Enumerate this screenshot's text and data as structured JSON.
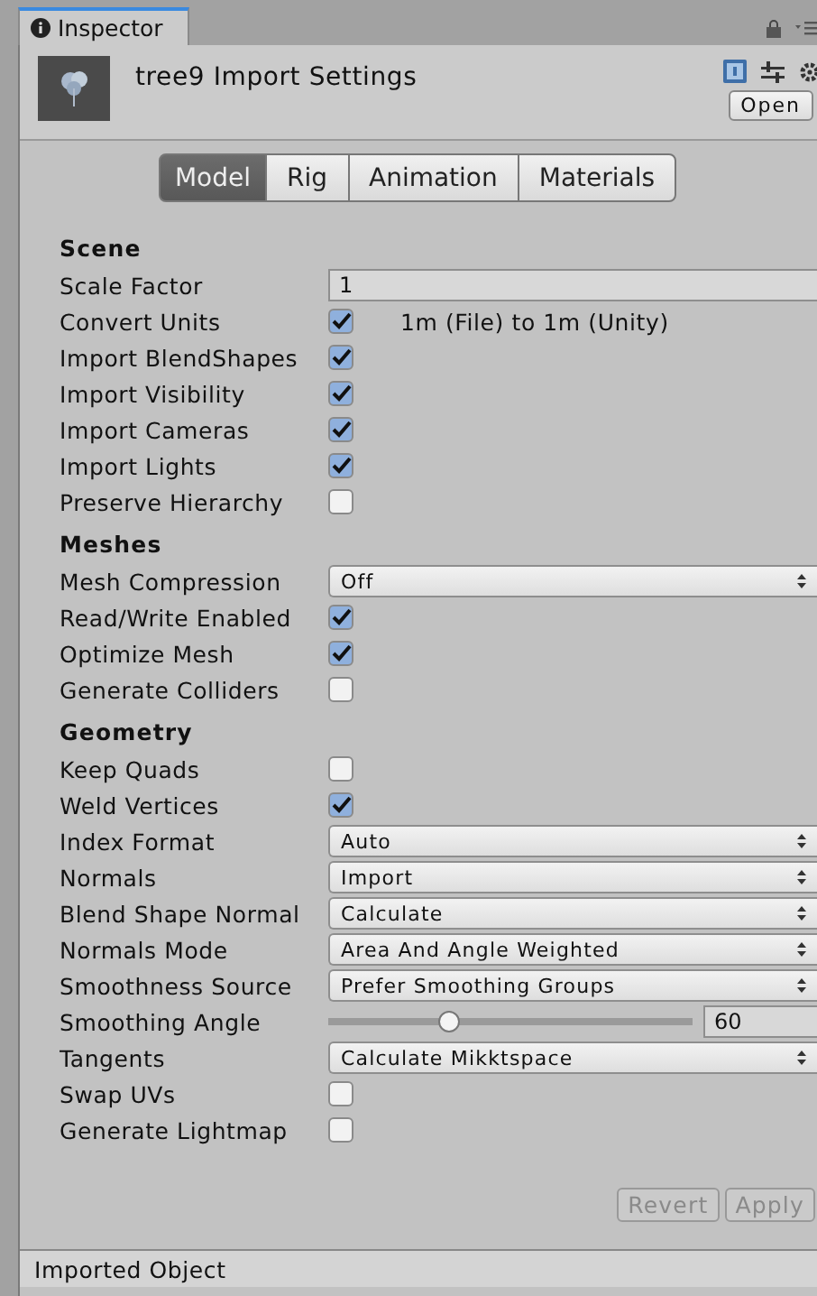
{
  "window": {
    "tab": "Inspector"
  },
  "header": {
    "title": "tree9 Import Settings",
    "open_button": "Open"
  },
  "tabs": [
    {
      "label": "Model",
      "selected": true
    },
    {
      "label": "Rig",
      "selected": false
    },
    {
      "label": "Animation",
      "selected": false
    },
    {
      "label": "Materials",
      "selected": false
    }
  ],
  "sections": [
    {
      "title": "Scene",
      "rows": [
        {
          "kind": "text",
          "label": "Scale Factor",
          "value": "1"
        },
        {
          "kind": "checkbox",
          "label": "Convert Units",
          "checked": true,
          "note": "1m (File) to 1m (Unity)"
        },
        {
          "kind": "checkbox",
          "label": "Import BlendShapes",
          "checked": true
        },
        {
          "kind": "checkbox",
          "label": "Import Visibility",
          "checked": true
        },
        {
          "kind": "checkbox",
          "label": "Import Cameras",
          "checked": true
        },
        {
          "kind": "checkbox",
          "label": "Import Lights",
          "checked": true
        },
        {
          "kind": "checkbox",
          "label": "Preserve Hierarchy",
          "checked": false
        }
      ]
    },
    {
      "title": "Meshes",
      "rows": [
        {
          "kind": "dropdown",
          "label": "Mesh Compression",
          "value": "Off"
        },
        {
          "kind": "checkbox",
          "label": "Read/Write Enabled",
          "checked": true
        },
        {
          "kind": "checkbox",
          "label": "Optimize Mesh",
          "checked": true
        },
        {
          "kind": "checkbox",
          "label": "Generate Colliders",
          "checked": false
        }
      ]
    },
    {
      "title": "Geometry",
      "rows": [
        {
          "kind": "checkbox",
          "label": "Keep Quads",
          "checked": false
        },
        {
          "kind": "checkbox",
          "label": "Weld Vertices",
          "checked": true
        },
        {
          "kind": "dropdown",
          "label": "Index Format",
          "value": "Auto"
        },
        {
          "kind": "dropdown",
          "label": "Normals",
          "value": "Import"
        },
        {
          "kind": "dropdown",
          "label": "Blend Shape Normal",
          "value": "Calculate"
        },
        {
          "kind": "dropdown",
          "label": "Normals Mode",
          "value": "Area And Angle Weighted"
        },
        {
          "kind": "dropdown",
          "label": "Smoothness Source",
          "value": "Prefer Smoothing Groups"
        },
        {
          "kind": "slider",
          "label": "Smoothing Angle",
          "level": 0.33,
          "value": "60"
        },
        {
          "kind": "dropdown",
          "label": "Tangents",
          "value": "Calculate Mikktspace"
        },
        {
          "kind": "checkbox",
          "label": "Swap UVs",
          "checked": false
        },
        {
          "kind": "checkbox",
          "label": "Generate Lightmap",
          "checked": false
        }
      ]
    }
  ],
  "buttons": [
    {
      "label": "Revert",
      "disabled": true
    },
    {
      "label": "Apply",
      "disabled": true
    }
  ],
  "status_bar": "Imported Object"
}
